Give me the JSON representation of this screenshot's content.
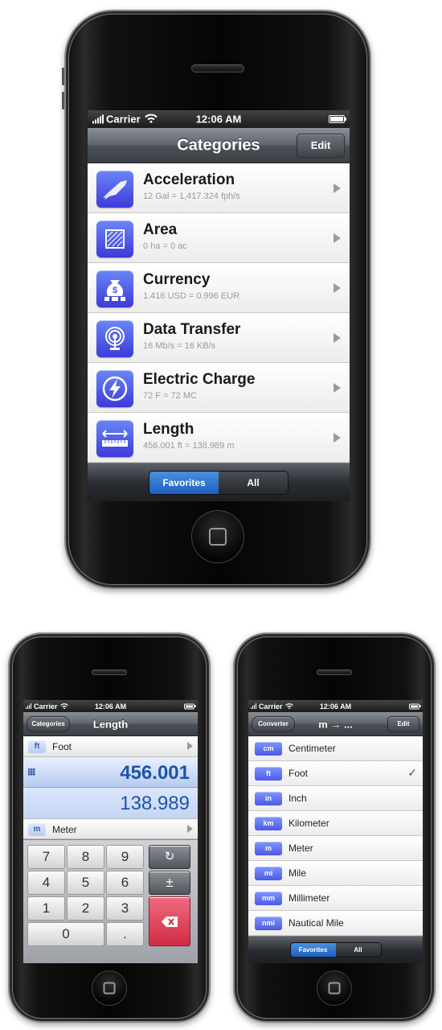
{
  "status": {
    "carrier": "Carrier",
    "time": "12:06 AM"
  },
  "main": {
    "title": "Categories",
    "edit": "Edit",
    "rows": [
      {
        "name": "Acceleration",
        "sub": "12 Gal = 1,417.324 fph/s",
        "icon": "acceleration-icon"
      },
      {
        "name": "Area",
        "sub": "0 ha = 0 ac",
        "icon": "area-icon"
      },
      {
        "name": "Currency",
        "sub": "1.416 USD = 0.996 EUR",
        "icon": "currency-icon"
      },
      {
        "name": "Data Transfer",
        "sub": "16 Mb/s = 16 KB/s",
        "icon": "data-transfer-icon"
      },
      {
        "name": "Electric Charge",
        "sub": "72 F = 72 MC",
        "icon": "electric-charge-icon"
      },
      {
        "name": "Length",
        "sub": "456.001 ft = 138.989 m",
        "icon": "length-icon"
      }
    ],
    "seg": {
      "favorites": "Favorites",
      "all": "All"
    }
  },
  "left": {
    "back": "Categories",
    "title": "Length",
    "from_abbr": "ft",
    "from_name": "Foot",
    "value1": "456.001",
    "value2": "138.989",
    "to_abbr": "m",
    "to_name": "Meter",
    "keys": [
      "7",
      "8",
      "9",
      "4",
      "5",
      "6",
      "1",
      "2",
      "3",
      "0",
      "."
    ],
    "swap": "↻",
    "plusminus": "±"
  },
  "right": {
    "back": "Converter",
    "title": "m → ...",
    "edit": "Edit",
    "checkmark": "✓",
    "units": [
      {
        "abbr": "cm",
        "name": "Centimeter",
        "checked": false
      },
      {
        "abbr": "ft",
        "name": "Foot",
        "checked": true
      },
      {
        "abbr": "in",
        "name": "Inch",
        "checked": false
      },
      {
        "abbr": "km",
        "name": "Kilometer",
        "checked": false
      },
      {
        "abbr": "m",
        "name": "Meter",
        "checked": false
      },
      {
        "abbr": "mi",
        "name": "Mile",
        "checked": false
      },
      {
        "abbr": "mm",
        "name": "Millimeter",
        "checked": false
      },
      {
        "abbr": "nmi",
        "name": "Nautical Mile",
        "checked": false
      }
    ],
    "seg": {
      "favorites": "Favorites",
      "all": "All"
    }
  },
  "colors": {
    "accent": "#1e5fc0",
    "value_blue": "#1d55a8",
    "icon_purple": "#4d58e6",
    "delete_red": "#cf2c44"
  }
}
